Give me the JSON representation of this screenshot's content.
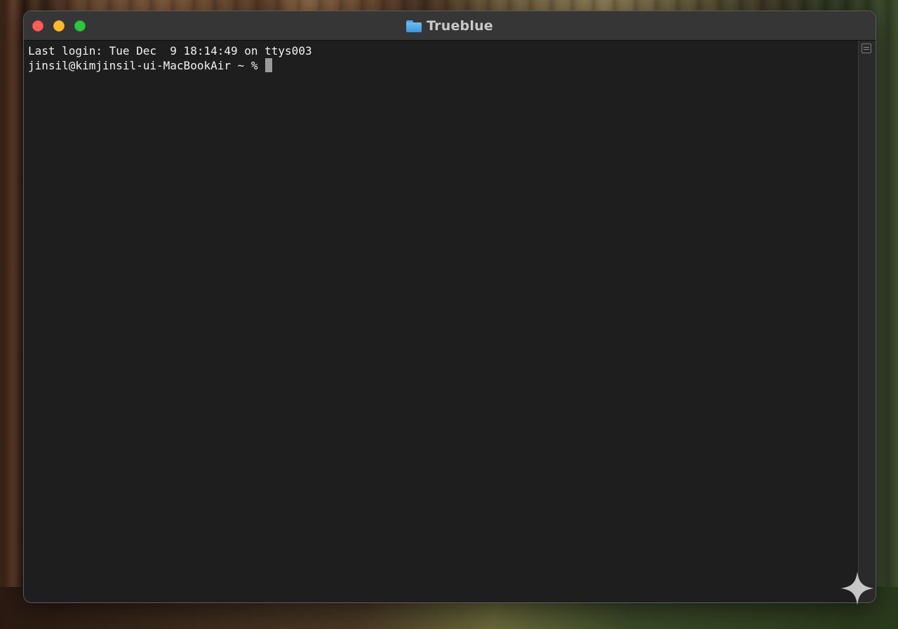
{
  "window": {
    "title": "Trueblue",
    "title_icon": "folder-icon"
  },
  "terminal": {
    "lines": [
      "Last login: Tue Dec  9 18:14:49 on ttys003",
      "jinsil@kimjinsil-ui-MacBookAir ~ % "
    ]
  },
  "colors": {
    "close": "#ff5f57",
    "minimize": "#febc2e",
    "maximize": "#28c840",
    "terminal_bg": "#1e1e1e",
    "terminal_text": "#f2f2f2"
  }
}
